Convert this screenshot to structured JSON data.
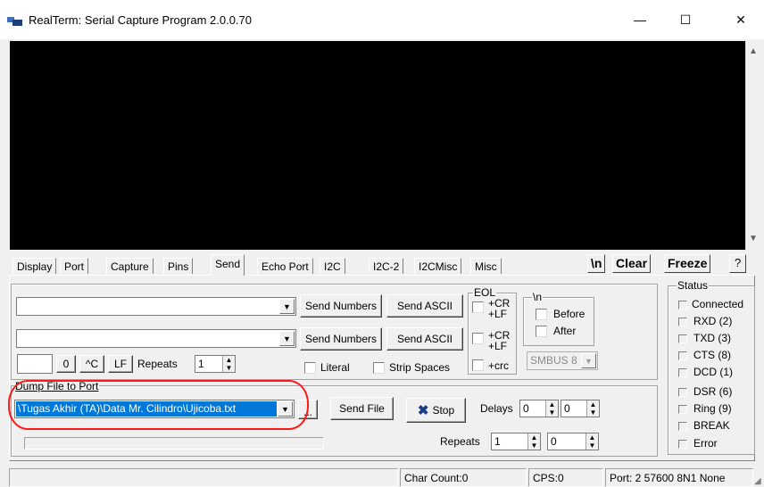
{
  "window": {
    "title": "RealTerm: Serial Capture Program 2.0.0.70",
    "minimize": "—",
    "maximize": "☐",
    "close": "✕"
  },
  "tabs": [
    "Display",
    "Port",
    "Capture",
    "Pins",
    "Send",
    "Echo Port",
    "I2C",
    "I2C-2",
    "I2CMisc",
    "Misc"
  ],
  "active_tab": "Send",
  "header_buttons": {
    "newline": "\\n",
    "clear": "Clear",
    "freeze": "Freeze",
    "help": "?"
  },
  "send": {
    "send_numbers": "Send Numbers",
    "send_ascii": "Send ASCII",
    "send_numbers_2": "Send Numbers",
    "send_ascii_2": "Send ASCII",
    "small_value": "0",
    "ctrl_c": "^C",
    "lf": "LF",
    "repeats_label": "Repeats",
    "repeats_value": "1",
    "literal": "Literal",
    "strip_spaces": "Strip Spaces",
    "eol": {
      "caption": "EOL",
      "cr": "+CR",
      "lf": "+LF",
      "cr2": "+CR",
      "lf2": "+LF",
      "crc": "+crc"
    },
    "newline_group": {
      "caption": "\\n",
      "before": "Before",
      "after": "After"
    },
    "smbus": "SMBUS 8"
  },
  "dump": {
    "caption": "Dump File to Port",
    "file_path": "\\Tugas Akhir (TA)\\Data Mr. Cilindro\\Ujicoba.txt",
    "browse": "...",
    "send_file": "Send File",
    "stop": "Stop",
    "delays_label": "Delays",
    "delay1": "0",
    "delay2": "0",
    "repeats_label": "Repeats",
    "repeats1": "1",
    "repeats2": "0",
    "progress_text": "............"
  },
  "status": {
    "caption": "Status",
    "items": [
      "Connected",
      "RXD (2)",
      "TXD (3)",
      "CTS (8)",
      "DCD (1)",
      "DSR (6)",
      "Ring (9)",
      "BREAK",
      "Error"
    ]
  },
  "statusbar": {
    "char_count": "Char Count:0",
    "cps": "CPS:0",
    "port": "Port: 2 57600 8N1 None"
  },
  "colors": {
    "terminal_bg": "#000000",
    "selection": "#0078d7",
    "annotation": "#ff1a1a",
    "stop_icon": "#1a3a8a"
  }
}
